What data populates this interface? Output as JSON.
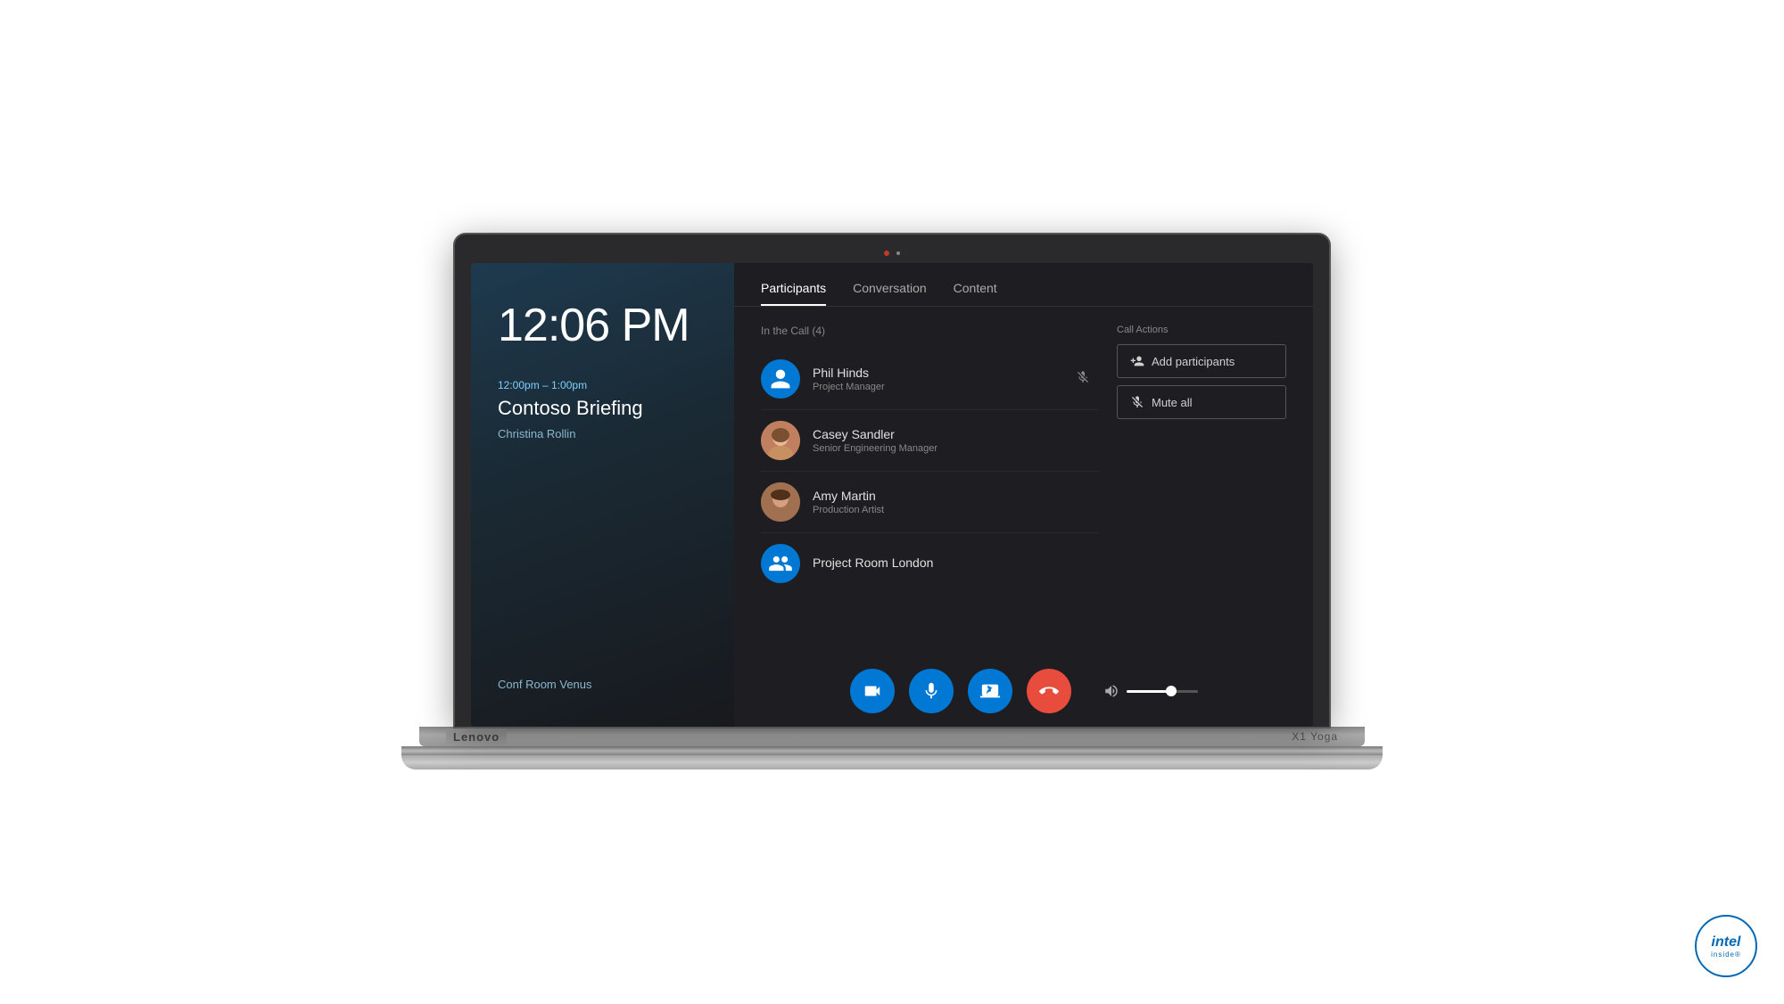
{
  "laptop": {
    "brand": "Lenovo",
    "model": "X1 Yoga",
    "intel": {
      "text": "intel",
      "inside": "inside®"
    }
  },
  "left_panel": {
    "time": "12:06 PM",
    "meeting_time_range": "12:00pm – 1:00pm",
    "meeting_title": "Contoso Briefing",
    "organizer": "Christina Rollin",
    "room": "Conf Room Venus"
  },
  "tabs": [
    {
      "id": "participants",
      "label": "Participants",
      "active": true
    },
    {
      "id": "conversation",
      "label": "Conversation",
      "active": false
    },
    {
      "id": "content",
      "label": "Content",
      "active": false
    }
  ],
  "participants": {
    "section_label": "In the Call (4)",
    "people": [
      {
        "id": "phil-hinds",
        "name": "Phil Hinds",
        "role": "Project Manager",
        "avatar_type": "icon",
        "muted": true
      },
      {
        "id": "casey-sandler",
        "name": "Casey Sandler",
        "role": "Senior Engineering Manager",
        "avatar_type": "photo-casey",
        "muted": false
      },
      {
        "id": "amy-martin",
        "name": "Amy Martin",
        "role": "Production Artist",
        "avatar_type": "photo-amy",
        "muted": false
      },
      {
        "id": "project-room-london",
        "name": "Project Room London",
        "role": "",
        "avatar_type": "group",
        "muted": false
      }
    ]
  },
  "call_actions": {
    "label": "Call Actions",
    "buttons": [
      {
        "id": "add-participants",
        "label": "Add participants"
      },
      {
        "id": "mute-all",
        "label": "Mute all"
      }
    ]
  },
  "controls": {
    "video_label": "video",
    "mic_label": "microphone",
    "share_label": "share screen",
    "hangup_label": "hang up",
    "volume_label": "volume",
    "volume_percent": 60
  }
}
